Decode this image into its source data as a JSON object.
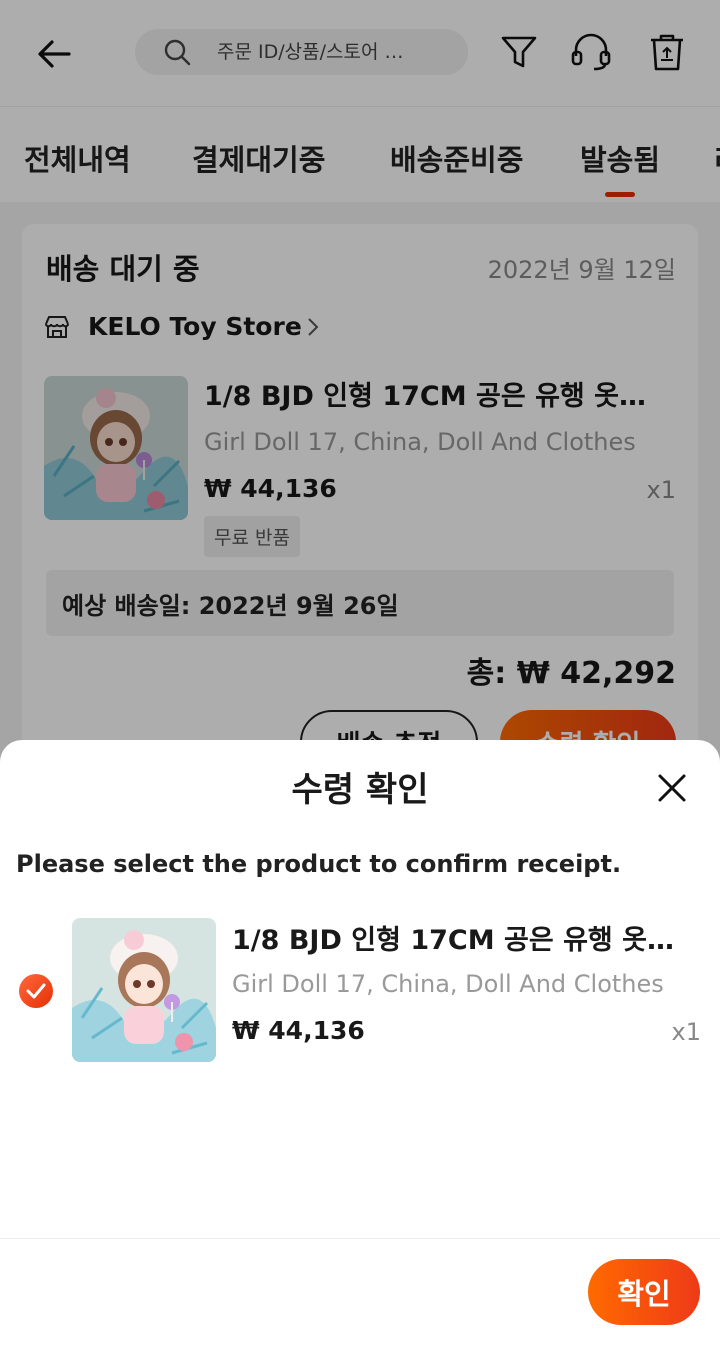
{
  "header": {
    "search_placeholder": "주문 ID/상품/스토어 …"
  },
  "tabs": [
    {
      "label": "전체내역"
    },
    {
      "label": "결제대기중"
    },
    {
      "label": "배송준비중"
    },
    {
      "label": "발송됨",
      "active": true
    },
    {
      "label": "리"
    }
  ],
  "order": {
    "status": "배송 대기 중",
    "date": "2022년 9월 12일",
    "store": "KELO Toy Store",
    "product": {
      "title": "1/8 BJD 인형 17CM 공은 유행 옷…",
      "attributes": "Girl Doll 17, China, Doll And Clothes",
      "price": "₩ 44,136",
      "qty": "x1",
      "tag": "무료 반품"
    },
    "estimated_delivery": "예상 배송일: 2022년 9월 26일",
    "total": "총: ₩ 42,292",
    "track_button": "배송 추적",
    "confirm_button": "수령 확인"
  },
  "sheet": {
    "title": "수령 확인",
    "description": "Please select the product to confirm receipt.",
    "item": {
      "title": "1/8 BJD 인형 17CM 공은 유행 옷…",
      "attributes": "Girl Doll 17, China, Doll And Clothes",
      "price": "₩ 44,136",
      "qty": "x1",
      "selected": true
    },
    "confirm_label": "확인"
  },
  "colors": {
    "accent": "#e62e04",
    "accent_gradient_start": "#ff6a00"
  }
}
